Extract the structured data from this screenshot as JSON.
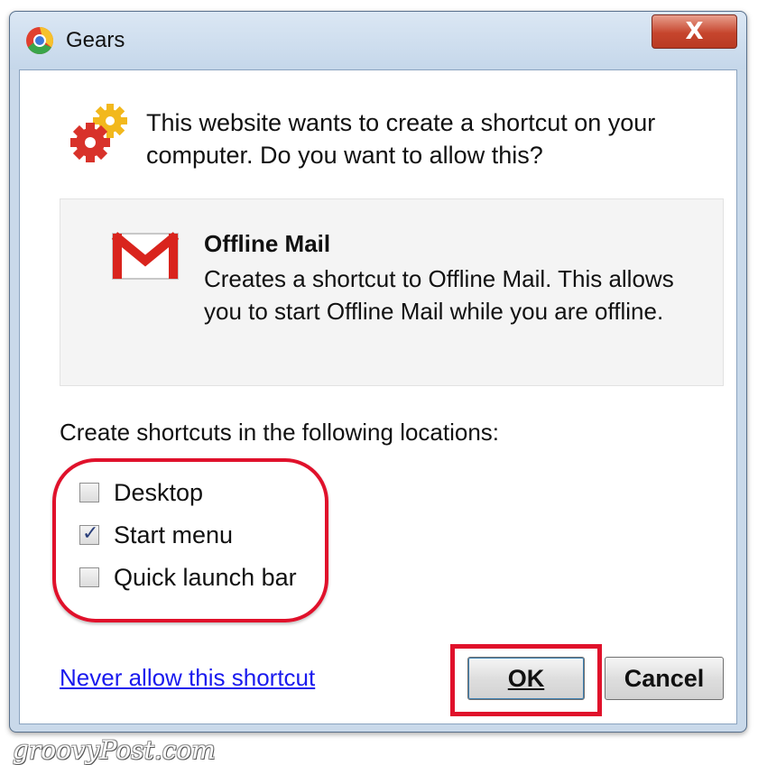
{
  "window": {
    "title": "Gears",
    "close_label": "X",
    "app_icon": "chrome-icon"
  },
  "prompt": {
    "icon": "gears-icon",
    "text": "This website wants to create a shortcut on your computer. Do you want to allow this?"
  },
  "shortcut_info": {
    "icon": "gmail-icon",
    "name": "Offline Mail",
    "description": "Creates a shortcut to Offline Mail. This allows you to start Offline Mail while you are offline."
  },
  "locations": {
    "label": "Create shortcuts in the following locations:",
    "options": [
      {
        "label": "Desktop",
        "checked": false
      },
      {
        "label": "Start menu",
        "checked": true
      },
      {
        "label": "Quick launch bar",
        "checked": false
      }
    ]
  },
  "actions": {
    "never_allow_link": "Never allow this shortcut",
    "ok_label": "OK",
    "cancel_label": "Cancel"
  },
  "watermark": "groovyPost.com",
  "colors": {
    "highlight": "#e0112b",
    "link": "#1a1aee",
    "titlebar": "#c9d9ea"
  }
}
